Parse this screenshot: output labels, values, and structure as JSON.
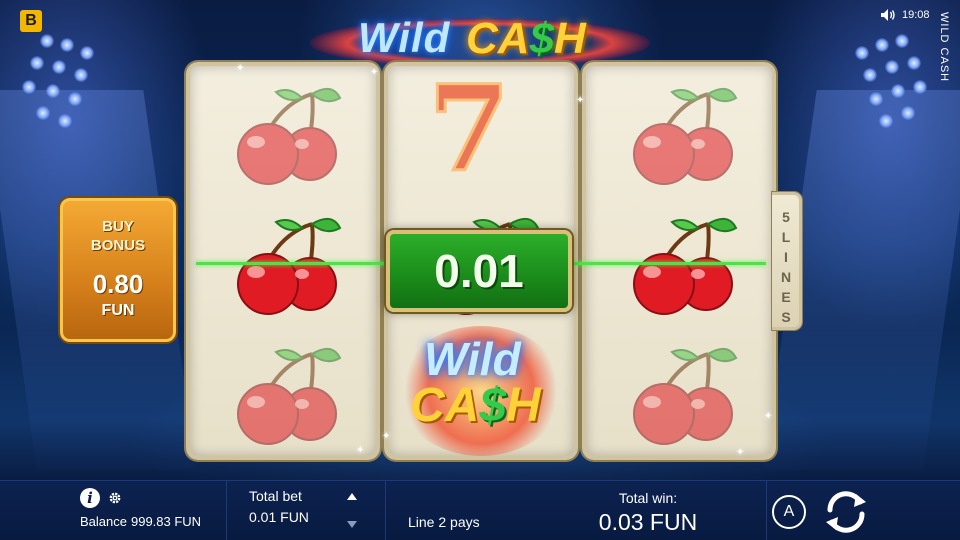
{
  "game": {
    "side_title": "WILD CASH",
    "logo": {
      "word_wild": "Wild",
      "word_cash_pre": "CA",
      "word_cash_dollar": "$",
      "word_cash_post": "H"
    },
    "brand_letter": "B"
  },
  "status": {
    "time": "19:08",
    "icon": "speaker-icon"
  },
  "buy_bonus": {
    "title_line1": "BUY",
    "title_line2": "BONUS",
    "price": "0.80",
    "currency": "FUN"
  },
  "lines_tab": {
    "label": "5\nL\nI\nN\nE\nS"
  },
  "reels": [
    [
      "cherry",
      "cherry",
      "cherry"
    ],
    [
      "seven",
      "cherry",
      "wild"
    ],
    [
      "cherry",
      "cherry",
      "cherry"
    ]
  ],
  "win_badge": {
    "amount": "0.01"
  },
  "bottom_bar": {
    "balance_label": "Balance",
    "balance_value": "999.83 FUN",
    "total_bet_label": "Total bet",
    "total_bet_value": "0.01 FUN",
    "line_pays": "Line 2 pays",
    "total_win_label": "Total win:",
    "total_win_value": "0.03 FUN",
    "auto_label": "A",
    "icons": [
      "info-icon",
      "gear-icon",
      "arrow-up-icon",
      "arrow-down-icon",
      "autoplay-icon",
      "spin-icon"
    ]
  },
  "colors": {
    "background": "#0b2a5c",
    "reel_face": "#f3eede",
    "payline": "#4fe04a",
    "win_green": "#2cae2a",
    "buy_bonus_orange": "#f4a934",
    "cherry_red": "#e01b24",
    "logo_gold": "#ffd23a"
  }
}
